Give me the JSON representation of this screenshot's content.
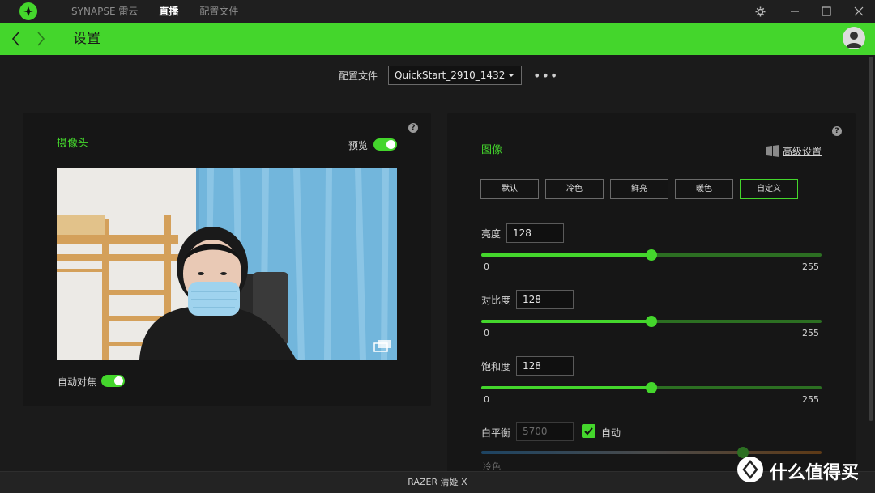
{
  "titlebar": {
    "tabs": [
      {
        "label": "SYNAPSE 雷云"
      },
      {
        "label": "直播"
      },
      {
        "label": "配置文件"
      }
    ]
  },
  "header": {
    "title": "设置"
  },
  "profile": {
    "label": "配置文件",
    "value": "QuickStart_2910_1432",
    "more": "•••"
  },
  "camera_panel": {
    "title": "摄像头",
    "preview_label": "预览",
    "preview_on": true,
    "autofocus_label": "自动对焦",
    "autofocus_on": true,
    "help": "?"
  },
  "image_panel": {
    "title": "图像",
    "advanced_label": "高级设置",
    "help": "?",
    "presets": [
      {
        "label": "默认",
        "selected": false
      },
      {
        "label": "冷色",
        "selected": false
      },
      {
        "label": "鲜亮",
        "selected": false
      },
      {
        "label": "暖色",
        "selected": false
      },
      {
        "label": "自定义",
        "selected": true
      }
    ],
    "sliders": [
      {
        "label": "亮度",
        "value": "128",
        "min": "0",
        "max": "255",
        "fraction": 0.5
      },
      {
        "label": "对比度",
        "value": "128",
        "min": "0",
        "max": "255",
        "fraction": 0.5
      },
      {
        "label": "饱和度",
        "value": "128",
        "min": "0",
        "max": "255",
        "fraction": 0.5
      }
    ],
    "white_balance": {
      "label": "白平衡",
      "value": "5700",
      "auto_label": "自动",
      "auto_checked": true,
      "min_label": "冷色",
      "fraction": 0.77
    }
  },
  "statusbar": {
    "device": "RAZER 清姬 X"
  },
  "watermark": {
    "text": "什么值得买",
    "logo_char": "值"
  },
  "colors": {
    "accent": "#44d62c",
    "background": "#1b1b1b",
    "panel": "#161616"
  }
}
